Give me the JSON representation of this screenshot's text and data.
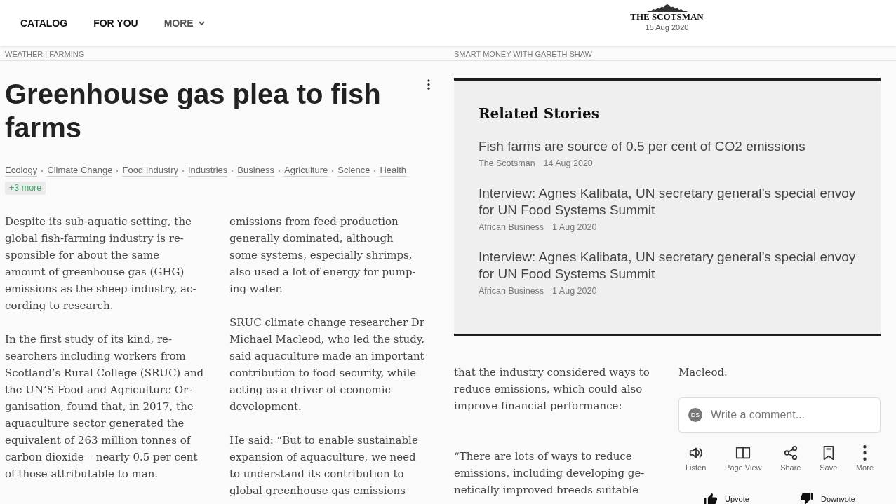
{
  "nav": [
    {
      "label": "CATALOG",
      "kind": "link"
    },
    {
      "label": "FOR YOU",
      "kind": "link"
    },
    {
      "label": "MORE",
      "kind": "dropdown"
    }
  ],
  "masthead": {
    "name": "THE SCOTSMAN",
    "date": "15 Aug 2020"
  },
  "left_page": {
    "section": "WEATHER | FARMING",
    "title": "Greenhouse gas plea to fish farms",
    "tags": [
      "Ecology",
      "Climate Change",
      "Food Industry",
      "Industries",
      "Business",
      "Agriculture",
      "Science",
      "Health"
    ],
    "more_tags": "+3 more",
    "columns": [
      [
        {
          "lines": [
            "Despite its sub-aquatic setting, the",
            "global fish-farming industry is re-",
            "sponsible for about the same",
            "amount of greenhouse gas (GHG)",
            "emissions as the sheep industry, ac-",
            "cording to research."
          ]
        },
        {
          "lines": [
            "In the first study of its kind, re-",
            "searchers including workers from",
            "Scotland’s Rural College (SRUC) and",
            "the UN’S Food and Agriculture Or-",
            "ganisation, found that, in 2017, the",
            "aquaculture sector generated the",
            "equivalent of 263 million tonnes of",
            "carbon dioxide – nearly 0.5 per cent",
            "of those attributable to man."
          ]
        }
      ],
      [
        {
          "lines": [
            "emissions from feed production",
            "generally dominated, although",
            "some systems, especially shrimps,",
            "also used a lot of energy for pump-",
            "ing water."
          ]
        },
        {
          "lines": [
            "SRUC climate change researcher Dr",
            "Michael Macleod, who led the study,",
            "said aquaculture made an important",
            "contribution to food security, while",
            "acting as a driver of economic",
            "development."
          ]
        },
        {
          "lines": [
            "He said: “But to enable sustainable",
            "expansion of aquaculture, we need",
            "to understand its contribution to",
            "global greenhouse gas emissions"
          ]
        }
      ]
    ]
  },
  "right_page": {
    "section": "SMART MONEY WITH GARETH SHAW",
    "related": {
      "title": "Related Stories",
      "stories": [
        {
          "title": "Fish farms are source of 0.5 per cent of CO2 emissions",
          "source": "The Scotsman",
          "date": "14 Aug 2020"
        },
        {
          "title": "Interview: Agnes Kalibata, UN secretary general’s special envoy for UN Food Systems Summit",
          "source": "African Business",
          "date": "1 Aug 2020"
        },
        {
          "title": "Interview: Agnes Kalibata, UN secretary general’s special envoy for UN Food Systems Summit",
          "source": "African Business",
          "date": "1 Aug 2020"
        }
      ]
    },
    "columns": [
      [
        {
          "lines": [
            "that the industry considered ways to",
            "reduce emissions, which could also",
            "improve financial performance:"
          ]
        },
        {
          "lines": [
            "“There are lots of ways to reduce",
            "emissions, including developing ge-",
            "netically improved breeds suitable"
          ]
        }
      ],
      [
        {
          "lines": [
            "Macleod."
          ]
        }
      ]
    ],
    "comment": {
      "avatar": "DS",
      "placeholder": "Write a comment..."
    },
    "actions": [
      {
        "label": "Listen",
        "kind": "listen"
      },
      {
        "label": "Page View",
        "kind": "pageview"
      },
      {
        "label": "Share",
        "kind": "share"
      },
      {
        "label": "Save",
        "kind": "save"
      },
      {
        "label": "More",
        "kind": "more"
      }
    ],
    "votes": [
      {
        "label": "Upvote",
        "kind": "up"
      },
      {
        "label": "Downvote",
        "kind": "down"
      }
    ]
  }
}
